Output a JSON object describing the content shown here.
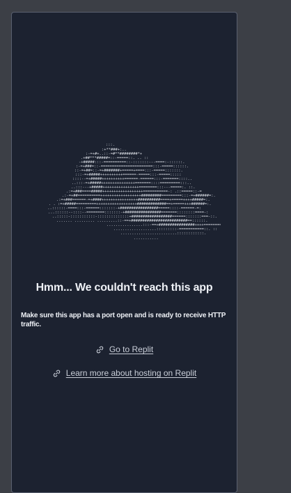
{
  "error": {
    "title": "Hmm... We couldn't reach this app",
    "description": "Make sure this app has a port open and is ready to receive HTTP traffic."
  },
  "links": {
    "replit": {
      "label": "Go to Replit",
      "icon": "link-icon"
    },
    "hosting": {
      "label": "Learn more about hosting on Replit",
      "icon": "link-icon"
    }
  },
  "colors": {
    "page_background": "#3c3f46",
    "panel_background": "#1c2230",
    "panel_border": "#5a6070",
    "text_primary": "#eef1f6",
    "text_link": "#c9ced8",
    "art": "#d7dbe2"
  },
  "illustration": {
    "icon": "ascii-cloud-art"
  }
}
